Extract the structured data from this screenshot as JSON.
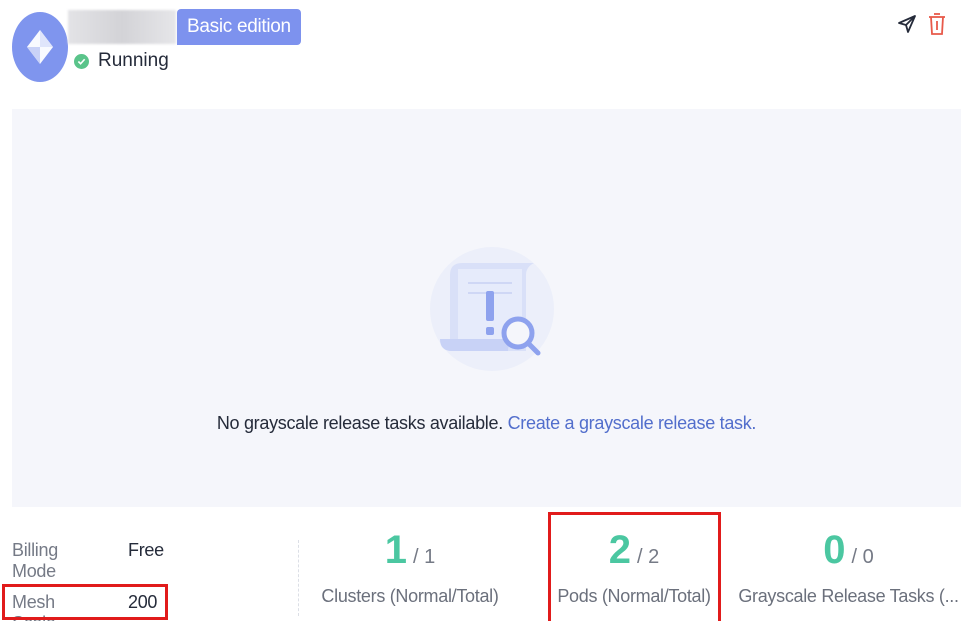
{
  "header": {
    "edition_badge": "Basic edition",
    "status_text": "Running",
    "status_color": "#5ac48a",
    "actions": [
      "send-icon",
      "delete-icon"
    ]
  },
  "empty_state": {
    "message": "No grayscale release tasks available.",
    "link": "Create a grayscale release task."
  },
  "info": {
    "billing_mode_label": "Billing Mode",
    "billing_mode_value": "Free",
    "mesh_scale_label": "Mesh Scale",
    "mesh_scale_value": "200"
  },
  "stats": {
    "clusters": {
      "value": "1",
      "total": "/ 1",
      "label": "Clusters (Normal/Total)"
    },
    "pods": {
      "value": "2",
      "total": "/ 2",
      "label": "Pods (Normal/Total)"
    },
    "tasks": {
      "value": "0",
      "total": "/ 0",
      "label": "Grayscale Release Tasks (..."
    }
  },
  "colors": {
    "accent": "#7d92ee",
    "stat_value": "#4bc7a1",
    "link": "#526ecc",
    "highlight": "#e11b1b"
  }
}
